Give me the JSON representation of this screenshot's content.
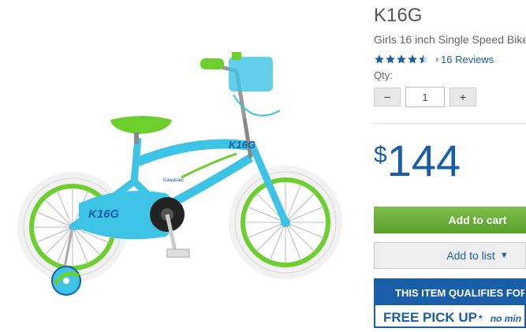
{
  "product": {
    "name": "K16G",
    "subtitle": "Girls 16 inch Single Speed Bike",
    "rating": 4.5,
    "reviews_label": "16 Reviews",
    "image_text": {
      "brand_top": "K16G",
      "brand_wheel": "K16G",
      "brand_small": "Kawasaki"
    }
  },
  "qty": {
    "label": "Qty:",
    "value": "1",
    "minus": "−",
    "plus": "+"
  },
  "price": {
    "currency": "$",
    "amount": "144"
  },
  "actions": {
    "add_to_cart": "Add to cart",
    "add_to_list": "Add to list"
  },
  "promo": {
    "banner": "THIS ITEM QUALIFIES FOR",
    "free_pickup": "FREE PICK UP",
    "asterisk": "*",
    "note": "no min"
  },
  "colors": {
    "accent_blue": "#1a5ea8",
    "cart_green": "#6aaf38",
    "bike_blue": "#3cc3e6",
    "bike_green": "#6ccf2e"
  }
}
